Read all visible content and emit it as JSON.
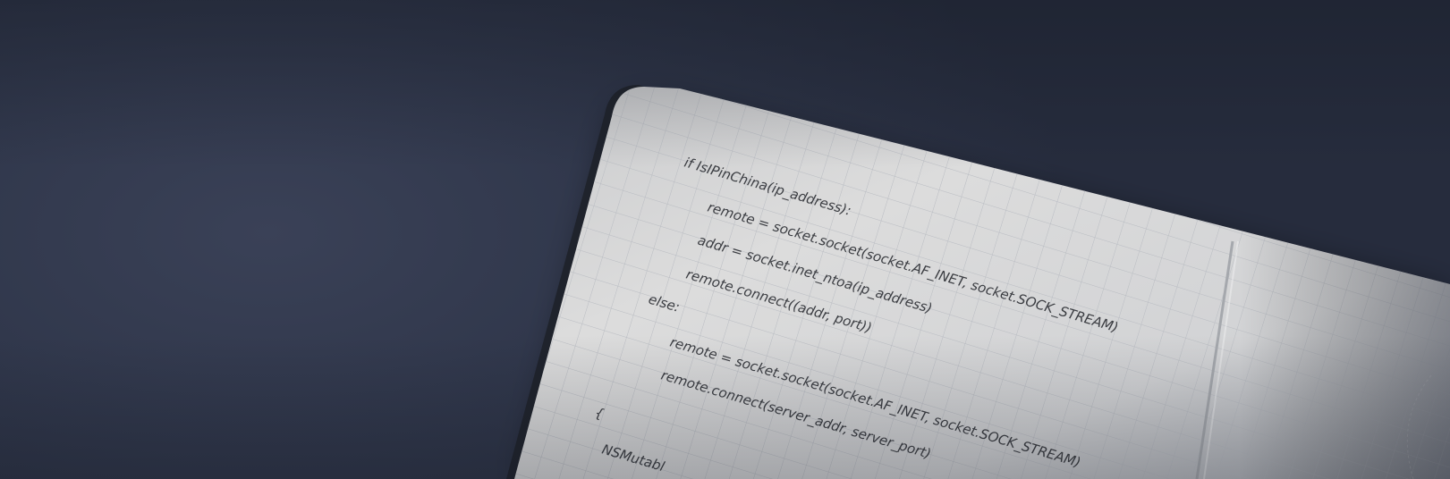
{
  "scene": {
    "description_label": "Notebook with handwritten code on dark background",
    "background_color": "#30374b",
    "paper_color": "#d9d9d9",
    "ink_color": "#3b3d42"
  },
  "code": {
    "lines": [
      "if IsIPinChina(ip_address):",
      "remote = socket.socket(socket.AF_INET, socket.SOCK_STREAM)",
      "addr = socket.inet_ntoa(ip_address)",
      "remote.connect((addr, port))",
      "else:",
      "remote = socket.socket(socket.AF_INET, socket.SOCK_STREAM)",
      "remote.connect(server_addr, server_port)",
      "{",
      "NSMutabl"
    ]
  }
}
